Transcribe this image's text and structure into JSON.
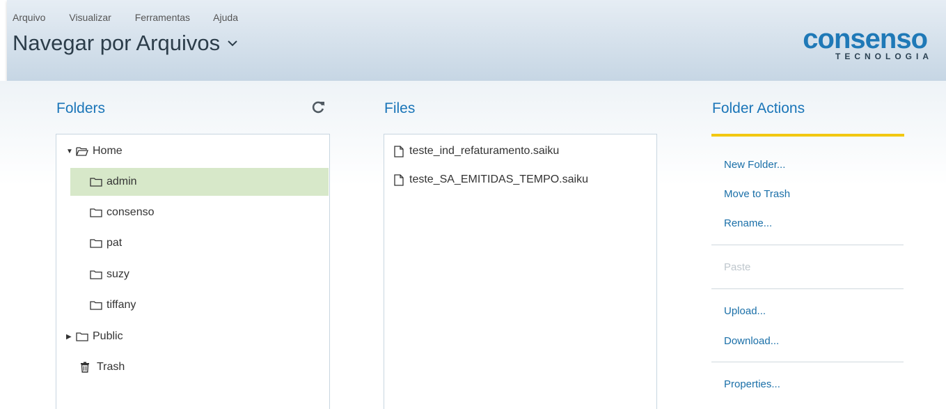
{
  "menu": [
    "Arquivo",
    "Visualizar",
    "Ferramentas",
    "Ajuda"
  ],
  "page_title": "Navegar por Arquivos",
  "logo": {
    "word": "consenso",
    "sub": "TECNOLOGIA",
    "color": "#1f79b7"
  },
  "folders": {
    "title": "Folders",
    "refresh_icon": "refresh-icon",
    "tree": {
      "home": "Home",
      "children": [
        "admin",
        "consenso",
        "pat",
        "suzy",
        "tiffany"
      ],
      "selected": "admin",
      "public": "Public",
      "trash": "Trash"
    }
  },
  "files": {
    "title": "Files",
    "items": [
      "teste_ind_refaturamento.saiku",
      "teste_SA_EMITIDAS_TEMPO.saiku"
    ]
  },
  "actions": {
    "title": "Folder Actions",
    "new_folder": "New Folder...",
    "move_to_trash": "Move to Trash",
    "rename": "Rename...",
    "paste": "Paste",
    "upload": "Upload...",
    "download": "Download...",
    "properties": "Properties..."
  },
  "colors": {
    "accent": "#1a75b8",
    "selected_row": "#d7e8c9",
    "action_bar": "#f2c811"
  }
}
